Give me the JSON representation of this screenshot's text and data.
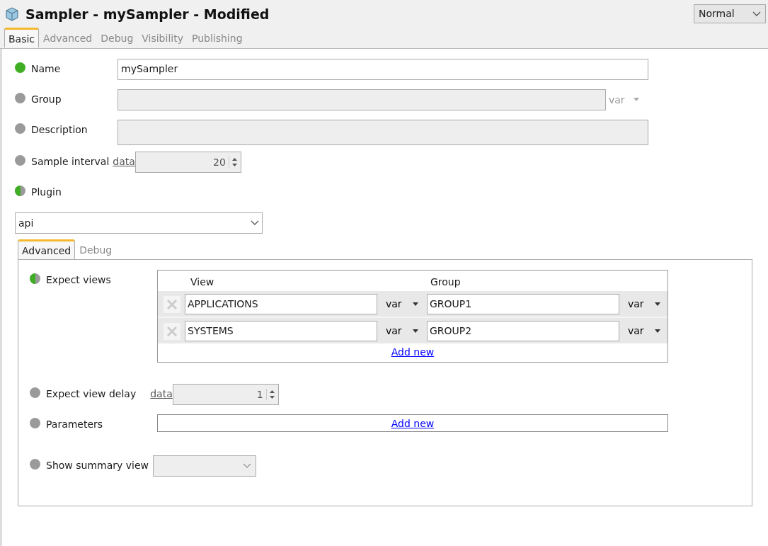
{
  "window": {
    "title": "Sampler - mySampler - Modified"
  },
  "mode_select": {
    "value": "Normal"
  },
  "tabs": [
    {
      "label": "Basic",
      "selected": true
    },
    {
      "label": "Advanced",
      "selected": false
    },
    {
      "label": "Debug",
      "selected": false
    },
    {
      "label": "Visibility",
      "selected": false
    },
    {
      "label": "Publishing",
      "selected": false
    }
  ],
  "fields": [
    {
      "kind": "text",
      "level": 1,
      "label": "Name",
      "value": "mySampler",
      "disabled": false
    },
    {
      "kind": "var-text",
      "level": 0,
      "label": "Group",
      "disabled": true,
      "var": "var"
    },
    {
      "kind": "textarea",
      "level": 0,
      "label": "Description",
      "disabled": true
    },
    {
      "kind": "spinner",
      "level": 0,
      "label": "Sample interval",
      "link": "data",
      "value": "20",
      "disabled": true
    },
    {
      "kind": "none",
      "level": 0.5,
      "label": "Plugin"
    }
  ],
  "plugin_select": {
    "value": "api"
  },
  "sub_tabs": [
    {
      "label": "Advanced",
      "selected": true
    },
    {
      "label": "Debug",
      "selected": false
    }
  ],
  "sub_fields": [
    {
      "kind": "table",
      "level": 0.5,
      "label": "Expect views",
      "columns": [
        "View",
        "Group"
      ],
      "rows": [
        {
          "view": "APPLICATIONS",
          "view_type": "var",
          "group": "GROUP1",
          "group_type": "var"
        },
        {
          "view": "SYSTEMS",
          "view_type": "var",
          "group": "GROUP2",
          "group_type": "var"
        }
      ],
      "add_link": "Add new"
    },
    {
      "kind": "spinner",
      "level": 0,
      "label": "Expect view delay",
      "link": "data",
      "value": "1",
      "disabled": true
    },
    {
      "kind": "add",
      "level": 0,
      "label": "Parameters",
      "add_link": "Add new"
    },
    {
      "kind": "select",
      "level": 0,
      "label": "Show summary view",
      "disabled": true
    }
  ]
}
